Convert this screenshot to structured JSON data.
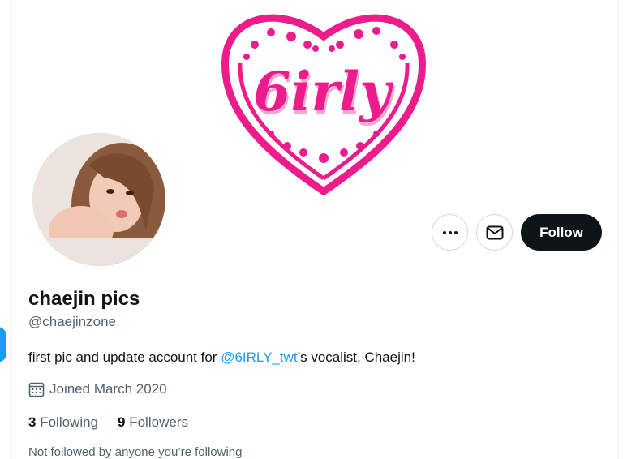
{
  "banner": {
    "logo_text": "6irly"
  },
  "profile": {
    "name": "chaejin pics",
    "handle": "@chaejinzone",
    "bio_prefix": "first pic and update account for ",
    "bio_mention": "@6IRLY_twt",
    "bio_suffix": "’s vocalist, Chaejin!",
    "joined": "Joined March 2020",
    "following_count": "3",
    "following_label": "Following",
    "followers_count": "9",
    "followers_label": "Followers",
    "not_followed_text": "Not followed by anyone you’re following"
  },
  "actions": {
    "follow_label": "Follow"
  },
  "colors": {
    "accent": "#1d9bf0",
    "brand_pink": "#ec1c8d",
    "button_dark": "#0f1419"
  }
}
